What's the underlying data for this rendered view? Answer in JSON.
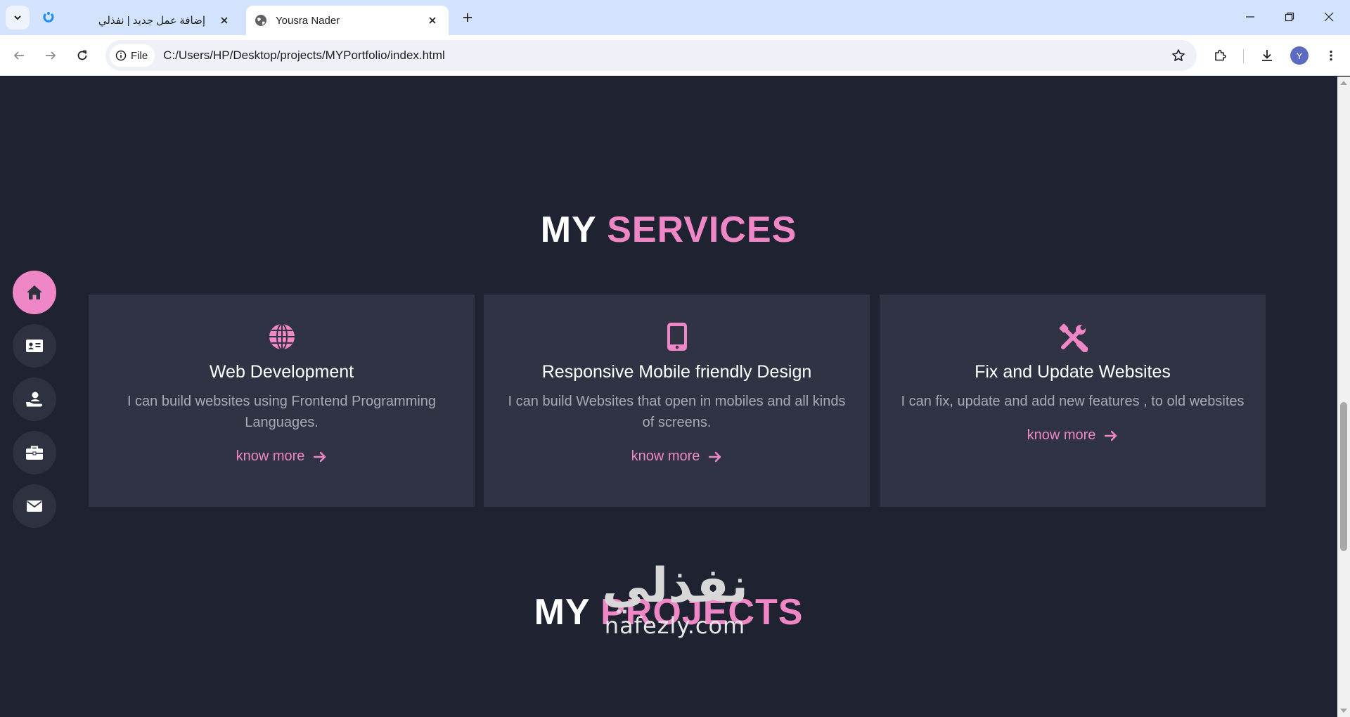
{
  "browser": {
    "tabs": [
      {
        "title": "إضافة عمل جديد | نفذلي",
        "active": false
      },
      {
        "title": "Yousra Nader",
        "active": true
      }
    ],
    "omnibox": {
      "scheme_label": "File",
      "url": "C:/Users/HP/Desktop/projects/MYPortfolio/index.html"
    },
    "profile_initial": "Y"
  },
  "page": {
    "services": {
      "title_prefix": "MY",
      "title_accent": "SERVICES",
      "cards": [
        {
          "icon": "globe-icon",
          "title": "Web Development",
          "description": "I can build websites using Frontend Programming Languages.",
          "link": "know more"
        },
        {
          "icon": "mobile-icon",
          "title": "Responsive Mobile friendly Design",
          "description": "I can build Websites that open in mobiles and all kinds of screens.",
          "link": "know more"
        },
        {
          "icon": "tools-icon",
          "title": "Fix and Update Websites",
          "description": "I can fix, update and add new features , to old websites",
          "link": "know more"
        }
      ]
    },
    "projects": {
      "title_prefix": "MY",
      "title_accent": "PROJECTS"
    },
    "side_nav": [
      "home-icon",
      "id-card-icon",
      "hand-user-icon",
      "briefcase-icon",
      "envelope-icon"
    ],
    "watermark": {
      "arabic": "نفذلي",
      "latin": "nafezly.com"
    }
  },
  "colors": {
    "background": "#1f2231",
    "card": "#2f3343",
    "accent": "#ef87c6",
    "nav_button": "#2e3140"
  }
}
